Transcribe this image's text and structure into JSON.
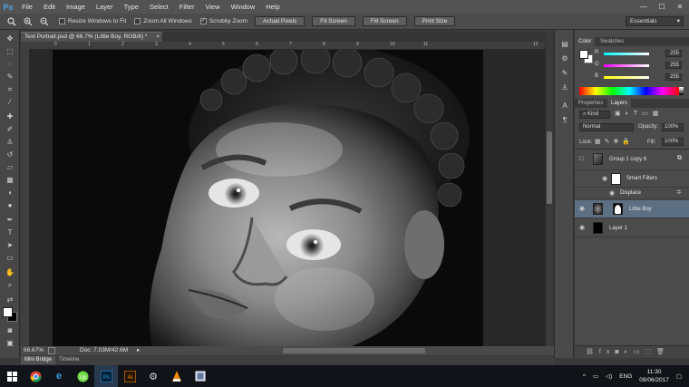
{
  "app": {
    "logo": "Ps",
    "menu": [
      "File",
      "Edit",
      "Image",
      "Layer",
      "Type",
      "Select",
      "Filter",
      "View",
      "Window",
      "Help"
    ],
    "window_controls": [
      "—",
      "☐",
      "✕"
    ]
  },
  "options_bar": {
    "resize_windows": "Resize Windows to Fit",
    "zoom_all": "Zoom All Windows",
    "scrubby_zoom": "Scrubby Zoom",
    "scrubby_checked": true,
    "buttons": [
      "Actual Pixels",
      "Fit Screen",
      "Fill Screen",
      "Print Size"
    ],
    "workspace": "Essentials"
  },
  "document": {
    "tab_title": "Text Portrait.psd @ 66.7% (Little Boy, RGB/8) *",
    "ruler_ticks": [
      "0",
      "1",
      "2",
      "3",
      "4",
      "5",
      "6",
      "7",
      "8",
      "9",
      "10",
      "11",
      "12"
    ],
    "zoom": "66.67%",
    "doc_info": "Doc: 7.03M/42.6M"
  },
  "bottom_tabs": [
    "Mini Bridge",
    "Timeline"
  ],
  "color_panel": {
    "tabs": [
      "Color",
      "Swatches"
    ],
    "r": "255",
    "g": "255",
    "b": "255",
    "labels": [
      "R",
      "G",
      "B"
    ]
  },
  "layers_panel": {
    "tabs": [
      "Properties",
      "Layers"
    ],
    "kind": "Kind",
    "blend_mode": "Normal",
    "opacity_label": "Opacity:",
    "opacity": "100%",
    "lock_label": "Lock:",
    "fill_label": "Fill:",
    "fill": "100%",
    "layers": [
      {
        "name": "Group 1 copy 6"
      },
      {
        "name": "Smart Filters"
      },
      {
        "name": "Displace"
      },
      {
        "name": "Little Boy"
      },
      {
        "name": "Layer 1"
      }
    ]
  },
  "taskbar": {
    "lang": "ENG",
    "time": "11:30",
    "date": "09/06/2017"
  }
}
